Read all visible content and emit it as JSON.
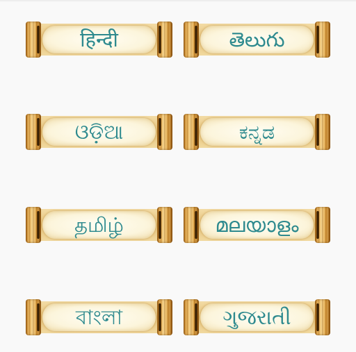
{
  "languages": {
    "hindi": "हिन्दी",
    "telugu": "తెలుగు",
    "odia": "ଓଡ଼ିଆ",
    "kannada": "ಕನ್ನಡ",
    "tamil": "தமிழ்",
    "malayalam": "മലയാളം",
    "bangla": "বাংলা",
    "gujarati": "ગુજરાતી"
  },
  "colors": {
    "label_text": "#2e8a8e",
    "background": "#f9f9f9",
    "paper": "#fcf5dc",
    "scroll_wood": "#d99b3d"
  },
  "icons": {
    "scroll_button": "parchment-scroll-icon"
  }
}
